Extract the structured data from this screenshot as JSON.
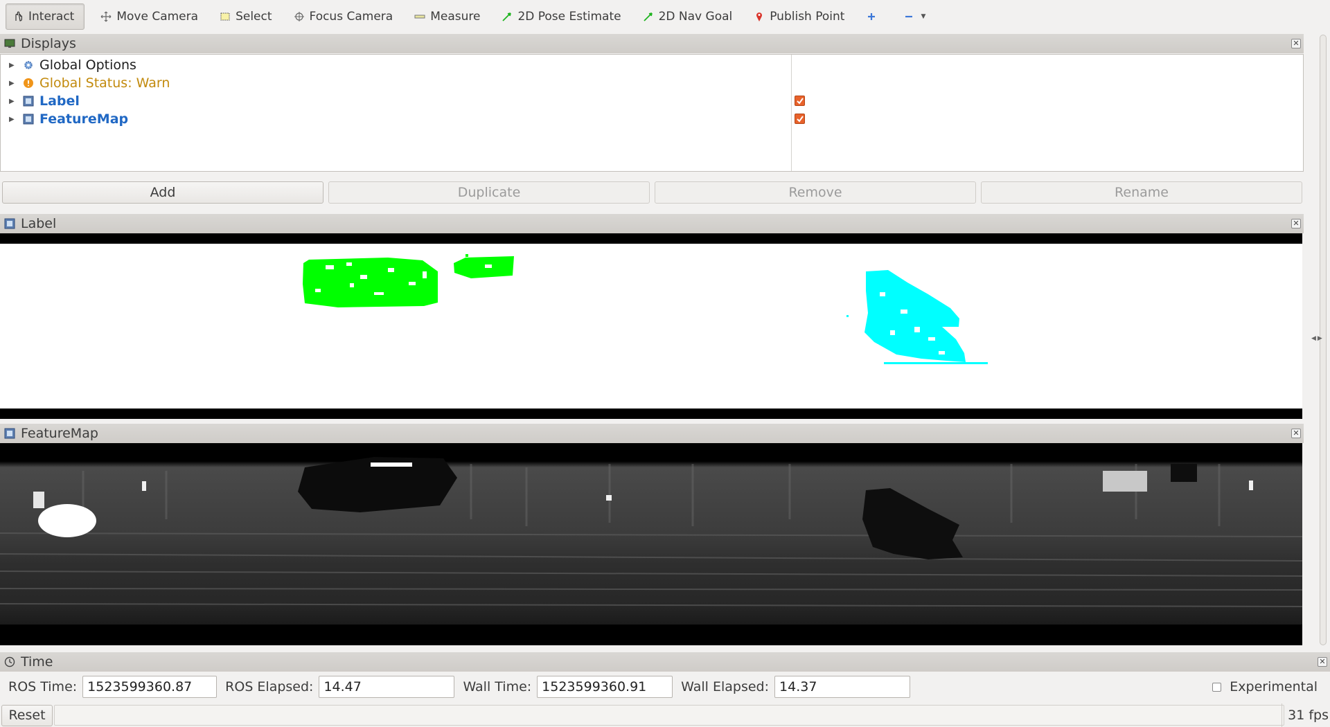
{
  "toolbar": {
    "tools": [
      {
        "label": "Interact",
        "icon": "hand-pointer-icon",
        "active": true
      },
      {
        "label": "Move Camera",
        "icon": "move-camera-icon"
      },
      {
        "label": "Select",
        "icon": "select-rectangle-icon"
      },
      {
        "label": "Focus Camera",
        "icon": "focus-target-icon"
      },
      {
        "label": "Measure",
        "icon": "ruler-icon"
      },
      {
        "label": "2D Pose Estimate",
        "icon": "green-arrow-icon"
      },
      {
        "label": "2D Nav Goal",
        "icon": "green-arrow-icon"
      },
      {
        "label": "Publish Point",
        "icon": "map-pin-icon"
      }
    ]
  },
  "displays": {
    "title": "Displays",
    "items": [
      {
        "label": "Global Options",
        "icon": "gear-icon",
        "style": "normal"
      },
      {
        "label": "Global Status: Warn",
        "icon": "warning-icon",
        "style": "warn"
      },
      {
        "label": "Label",
        "icon": "image-display-icon",
        "style": "display",
        "checked": true
      },
      {
        "label": "FeatureMap",
        "icon": "image-display-icon",
        "style": "display",
        "checked": true
      }
    ],
    "buttons": {
      "add": "Add",
      "duplicate": "Duplicate",
      "remove": "Remove",
      "rename": "Rename"
    }
  },
  "label_panel": {
    "title": "Label"
  },
  "feature_panel": {
    "title": "FeatureMap"
  },
  "time_panel": {
    "title": "Time",
    "ros_time_label": "ROS Time:",
    "ros_time": "1523599360.87",
    "ros_elapsed_label": "ROS Elapsed:",
    "ros_elapsed": "14.47",
    "wall_time_label": "Wall Time:",
    "wall_time": "1523599360.91",
    "wall_elapsed_label": "Wall Elapsed:",
    "wall_elapsed": "14.37",
    "experimental_label": "Experimental"
  },
  "status": {
    "reset_label": "Reset",
    "fps": "31 fps"
  },
  "colors": {
    "car_label": "#00ff00",
    "pedestrian_label": "#00ffff",
    "warn_text": "#c28a0d",
    "display_text": "#2068c4"
  }
}
